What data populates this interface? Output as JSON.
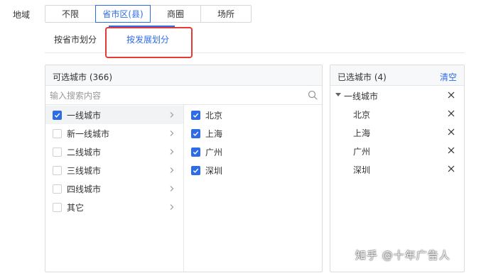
{
  "region": {
    "label": "地域"
  },
  "segments": [
    {
      "label": "不限",
      "active": false
    },
    {
      "label": "省市区(县)",
      "active": true
    },
    {
      "label": "商圈",
      "active": false
    },
    {
      "label": "场所",
      "active": false
    }
  ],
  "subtabs": [
    {
      "label": "按省市划分",
      "active": false
    },
    {
      "label": "按发展划分",
      "active": true
    }
  ],
  "available": {
    "title": "可选城市 (366)",
    "search_placeholder": "输入搜索内容",
    "categories": [
      {
        "label": "一线城市",
        "checked": true,
        "selected": true
      },
      {
        "label": "新一线城市",
        "checked": false,
        "selected": false
      },
      {
        "label": "二线城市",
        "checked": false,
        "selected": false
      },
      {
        "label": "三线城市",
        "checked": false,
        "selected": false
      },
      {
        "label": "四线城市",
        "checked": false,
        "selected": false
      },
      {
        "label": "其它",
        "checked": false,
        "selected": false
      }
    ],
    "cities": [
      {
        "label": "北京",
        "checked": true
      },
      {
        "label": "上海",
        "checked": true
      },
      {
        "label": "广州",
        "checked": true
      },
      {
        "label": "深圳",
        "checked": true
      }
    ]
  },
  "chosen": {
    "title": "已选城市 (4)",
    "clear_label": "清空",
    "group": "一线城市",
    "items": [
      "北京",
      "上海",
      "广州",
      "深圳"
    ]
  },
  "watermark": "知乎 @十年广告人",
  "colors": {
    "accent": "#2e6be6",
    "highlight_border": "#e53935"
  }
}
